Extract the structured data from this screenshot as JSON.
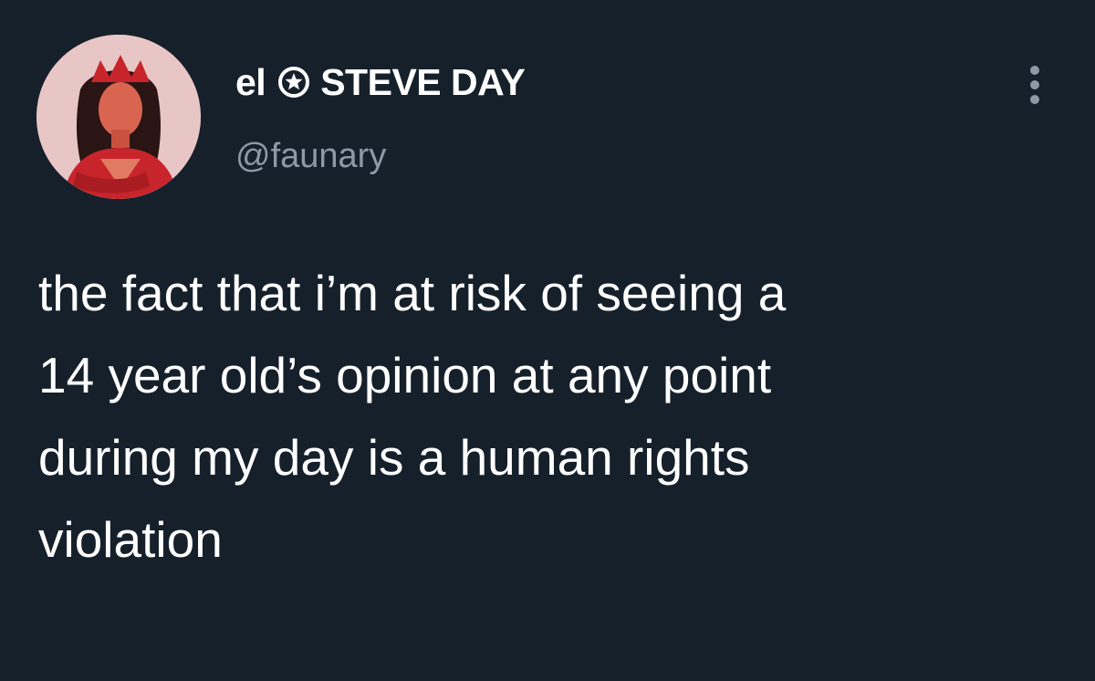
{
  "tweet": {
    "author": {
      "display_name_prefix": "el",
      "display_name_suffix": "STEVE DAY",
      "handle": "@faunary",
      "avatar_icon": "avatar-icon",
      "badge_icon": "star-badge-icon"
    },
    "text": "the fact that i’m at risk of seeing a\n14 year old’s opinion at any point\nduring my day is a human rights\nviolation",
    "more_icon": "more-vertical-icon"
  },
  "colors": {
    "background": "#16202b",
    "text": "#ffffff",
    "handle": "#8d99a5",
    "avatar_bg": "#e9c6c6",
    "accent_red": "#c8242c"
  }
}
